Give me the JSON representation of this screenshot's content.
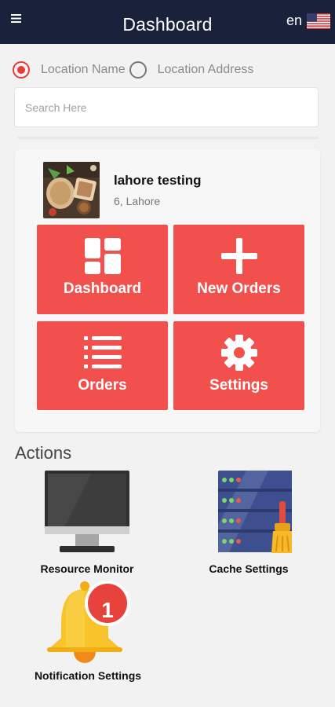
{
  "header": {
    "title": "Dashboard",
    "lang_code": "en",
    "flag_icon": "us-flag-icon",
    "bg_color": "#19213b"
  },
  "search_mode": {
    "options": [
      {
        "label": "Location Name",
        "selected": true
      },
      {
        "label": "Location Address",
        "selected": false
      }
    ],
    "accent_color": "#e63b36"
  },
  "search": {
    "placeholder": "Search Here",
    "value": ""
  },
  "location": {
    "name": "lahore testing",
    "address": "6, Lahore"
  },
  "tiles": [
    {
      "label": "Dashboard",
      "icon": "grid-icon"
    },
    {
      "label": "New Orders",
      "icon": "plus-icon"
    },
    {
      "label": "Orders",
      "icon": "list-icon"
    },
    {
      "label": "Settings",
      "icon": "gear-icon"
    }
  ],
  "tile_color": "#f1504d",
  "actions": {
    "title": "Actions",
    "items": [
      {
        "label": "Resource Monitor",
        "icon": "monitor-icon"
      },
      {
        "label": "Cache Settings",
        "icon": "server-broom-icon"
      },
      {
        "label": "Notification Settings",
        "icon": "bell-icon",
        "badge": "1"
      }
    ]
  }
}
